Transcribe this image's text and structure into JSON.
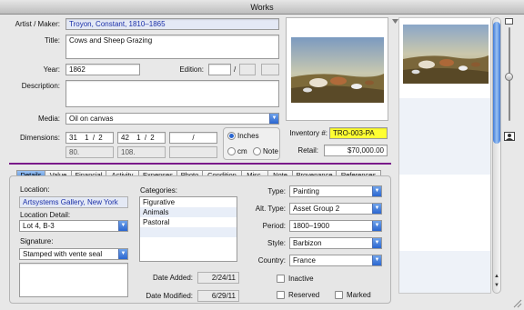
{
  "window": {
    "title": "Works"
  },
  "fields": {
    "artist_label": "Artist / Maker:",
    "artist_value": "Troyon, Constant, 1810–1865",
    "title_label": "Title:",
    "title_value": "Cows and Sheep Grazing",
    "year_label": "Year:",
    "year_value": "1862",
    "edition_label": "Edition:",
    "edition_sep": "/",
    "description_label": "Description:",
    "media_label": "Media:",
    "media_value": "Oil on canvas",
    "dimensions_label": "Dimensions:",
    "dim_h": "31",
    "dim_h_frac": "1 / 2",
    "dim_w": "42",
    "dim_w_frac": "1 / 2",
    "dim_d_sep": "/",
    "dim_cm_1": "80.",
    "dim_cm_2": "108.",
    "unit_inches": "Inches",
    "unit_cm": "cm",
    "unit_note": "Note",
    "inventory_label": "Inventory #:",
    "inventory_value": "TRO-003-PA",
    "retail_label": "Retail:",
    "retail_value": "$70,000.00"
  },
  "tabs": [
    "Details",
    "Value",
    "Financial",
    "Activity",
    "Expenses",
    "Photo",
    "Condition",
    "Misc.",
    "Note",
    "Provenance",
    "References"
  ],
  "details": {
    "location_label": "Location:",
    "location_value": "Artsystems Gallery, New York",
    "location_detail_label": "Location Detail:",
    "location_detail_value": "Lot 4, B-3",
    "signature_label": "Signature:",
    "signature_value": "Stamped with vente seal",
    "categories_label": "Categories:",
    "categories": [
      "Figurative",
      "Animals",
      "Pastoral"
    ],
    "date_added_label": "Date Added:",
    "date_added_value": "2/24/11",
    "date_modified_label": "Date Modified:",
    "date_modified_value": "6/29/11",
    "type_label": "Type:",
    "type_value": "Painting",
    "alt_type_label": "Alt. Type:",
    "alt_type_value": "Asset Group 2",
    "period_label": "Period:",
    "period_value": "1800–1900",
    "style_label": "Style:",
    "style_value": "Barbizon",
    "country_label": "Country:",
    "country_value": "France",
    "inactive_label": "Inactive",
    "reserved_label": "Reserved",
    "marked_label": "Marked"
  },
  "colors": {
    "accent": "#2a66d0",
    "divider": "#7a1a8a",
    "inventory_bg": "#ffff33",
    "link": "#1a2fa8"
  },
  "icons": [
    "disclosure-triangle-icon",
    "zoom-small-icon",
    "zoom-large-icon",
    "photo-icon",
    "popup-arrow-icon"
  ]
}
